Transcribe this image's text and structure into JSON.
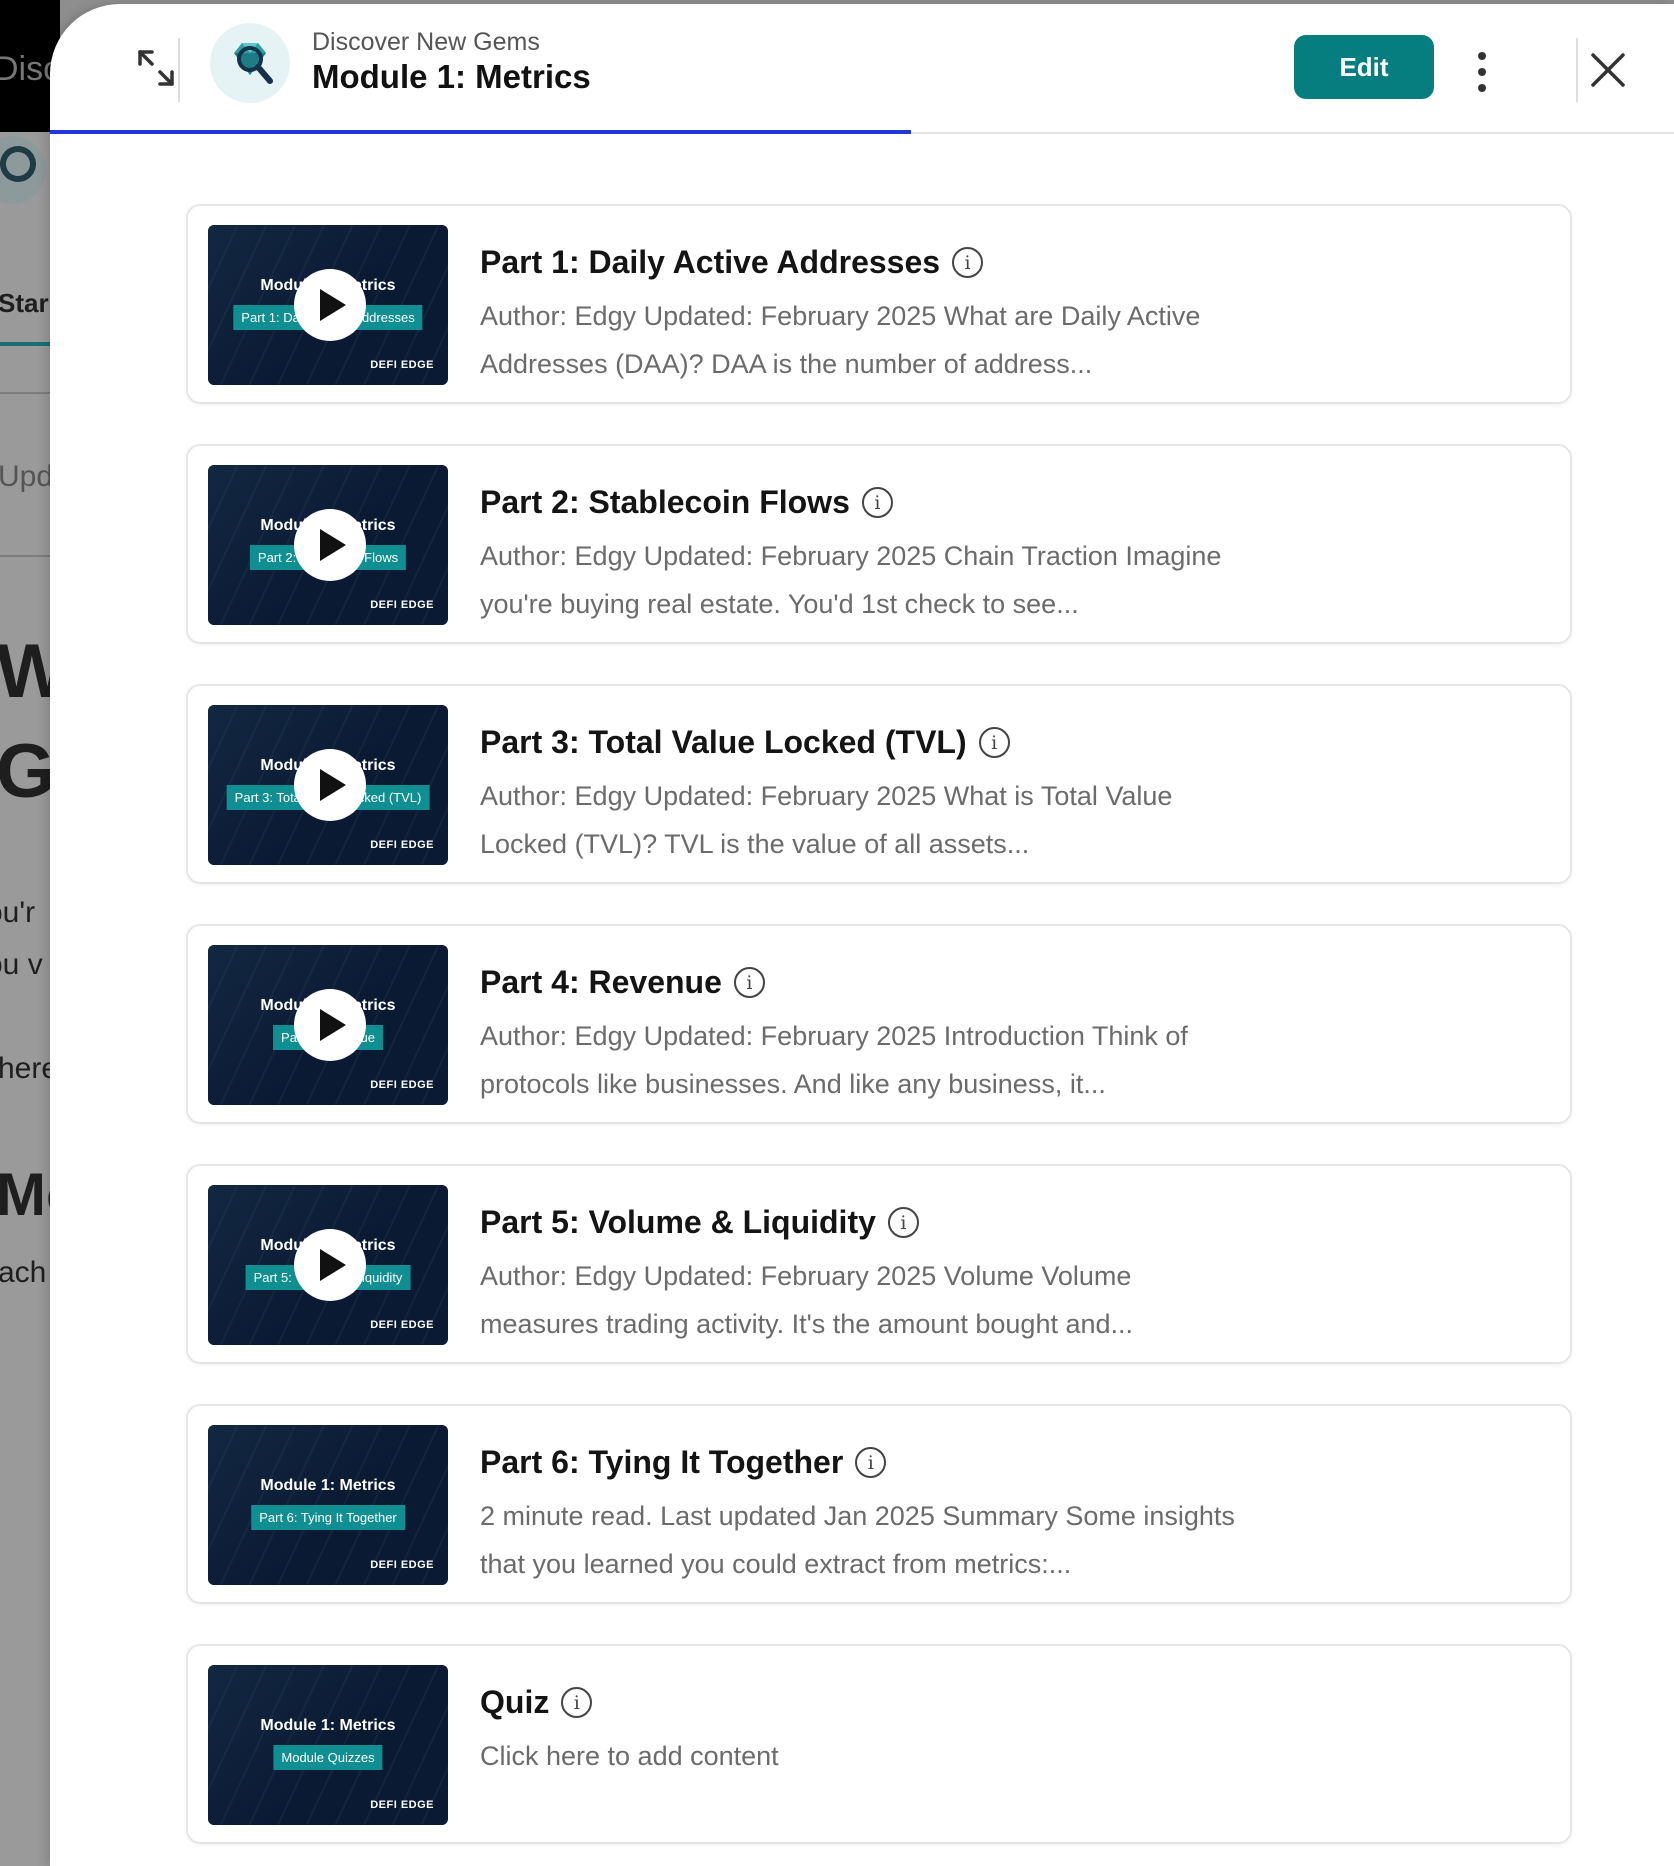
{
  "background": {
    "snippet_top": "Disco",
    "tab_text": "Star",
    "text_upd": "Upd",
    "heading_w": "W",
    "heading_g": "G",
    "text_ou_r": "ou'r",
    "text_ou_v": "ou v",
    "text_here": "here",
    "heading_mo": "Mo",
    "text_each": "ach"
  },
  "header": {
    "breadcrumb": "Discover New Gems",
    "title": "Module 1: Metrics",
    "edit_label": "Edit",
    "progress_fraction": 0.53,
    "icons": {
      "expand": "expand-arrows-icon",
      "more": "more-vertical-icon",
      "close": "close-icon",
      "logo": "diamond-magnifier-icon"
    },
    "accent_color": "#067d7e",
    "progress_color": "#2038d8"
  },
  "lessons": [
    {
      "title": "Part 1: Daily Active Addresses",
      "description": "Author: Edgy Updated: February 2025 What are Daily Active Addresses (DAA)? DAA is the number of address...",
      "thumb_title": "Module 1: Metrics",
      "thumb_subtitle": "Part 1: Daily Active Addresses",
      "thumb_brand": "DEFI EDGE",
      "has_video": true
    },
    {
      "title": "Part 2: Stablecoin Flows",
      "description": "Author: Edgy Updated: February 2025 Chain Traction Imagine you're buying real estate. You'd 1st check to see...",
      "thumb_title": "Module 1: Metrics",
      "thumb_subtitle": "Part 2: Stablecoin Flows",
      "thumb_brand": "DEFI EDGE",
      "has_video": true
    },
    {
      "title": "Part 3: Total Value Locked (TVL)",
      "description": "Author: Edgy Updated: February 2025 What is Total Value Locked (TVL)? TVL is the value of all assets...",
      "thumb_title": "Module 1: Metrics",
      "thumb_subtitle": "Part 3: Total Value Locked (TVL)",
      "thumb_brand": "DEFI EDGE",
      "has_video": true
    },
    {
      "title": "Part 4: Revenue",
      "description": "Author: Edgy Updated: February 2025 Introduction Think of protocols like businesses. And like any business, it...",
      "thumb_title": "Module 1: Metrics",
      "thumb_subtitle": "Part 4: Revenue",
      "thumb_brand": "DEFI EDGE",
      "has_video": true
    },
    {
      "title": "Part 5: Volume & Liquidity",
      "description": "Author: Edgy Updated: February 2025 Volume Volume measures trading activity. It's the amount bought and...",
      "thumb_title": "Module 1: Metrics",
      "thumb_subtitle": "Part 5: Volume & Liquidity",
      "thumb_brand": "DEFI EDGE",
      "has_video": true
    },
    {
      "title": "Part 6: Tying It Together",
      "description": "2 minute read. Last updated Jan 2025 Summary Some insights that you learned you could extract from metrics:...",
      "thumb_title": "Module 1: Metrics",
      "thumb_subtitle": "Part 6: Tying It Together",
      "thumb_brand": "DEFI EDGE",
      "has_video": false
    },
    {
      "title": "Quiz",
      "description": "Click here to add content",
      "thumb_title": "Module 1: Metrics",
      "thumb_subtitle": "Module Quizzes",
      "thumb_brand": "DEFI EDGE",
      "has_video": false
    }
  ]
}
